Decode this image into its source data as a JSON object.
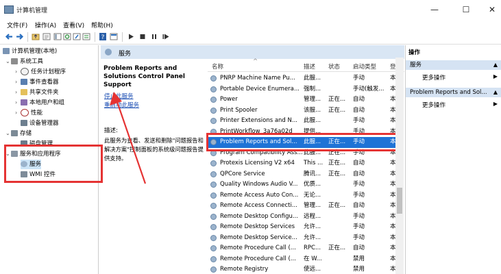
{
  "window": {
    "title": "计算机管理",
    "min": "—",
    "max": "☐",
    "close": "✕"
  },
  "menu": [
    "文件(F)",
    "操作(A)",
    "查看(V)",
    "帮助(H)"
  ],
  "tree": {
    "root": "计算机管理(本地)",
    "system_tools": "系统工具",
    "task_scheduler": "任务计划程序",
    "event_viewer": "事件查看器",
    "shared_folders": "共享文件夹",
    "local_users": "本地用户和组",
    "performance": "性能",
    "device_manager": "设备管理器",
    "storage": "存储",
    "disk_mgmt": "磁盘管理",
    "services_apps": "服务和应用程序",
    "services": "服务",
    "wmi": "WMI 控件"
  },
  "main": {
    "header": "服务",
    "desc_title": "Problem Reports and Solutions Control Panel Support",
    "stop_link": "停止此服务",
    "restart_link": "重启动此服务",
    "desc_label": "描述:",
    "desc_text": "此服务为查看、发送和删除\"问题报告和解决方案\"控制面板的系统级问题报告提供支持。"
  },
  "columns": {
    "name": "名称",
    "desc": "描述",
    "status": "状态",
    "startup": "启动类型",
    "logon": "登"
  },
  "services": [
    {
      "name": "PNRP Machine Name Pu...",
      "desc": "此服...",
      "status": "",
      "startup": "手动",
      "logon": "本"
    },
    {
      "name": "Portable Device Enumera...",
      "desc": "强制...",
      "status": "",
      "startup": "手动(触发...",
      "logon": "本"
    },
    {
      "name": "Power",
      "desc": "管理...",
      "status": "正在...",
      "startup": "自动",
      "logon": "本"
    },
    {
      "name": "Print Spooler",
      "desc": "该服...",
      "status": "正在...",
      "startup": "自动",
      "logon": "本"
    },
    {
      "name": "Printer Extensions and N...",
      "desc": "此服...",
      "status": "",
      "startup": "手动",
      "logon": "本"
    },
    {
      "name": "PrintWorkflow_3a76a02d",
      "desc": "提供...",
      "status": "",
      "startup": "手动",
      "logon": "本"
    },
    {
      "name": "Problem Reports and Sol...",
      "desc": "此服...",
      "status": "正在...",
      "startup": "手动",
      "logon": "本"
    },
    {
      "name": "Program Compatibility Ass...",
      "desc": "此服...",
      "status": "正在...",
      "startup": "手动",
      "logon": "本"
    },
    {
      "name": "Protexis Licensing V2 x64",
      "desc": "This ...",
      "status": "正在...",
      "startup": "自动",
      "logon": "本"
    },
    {
      "name": "QPCore Service",
      "desc": "腾讯...",
      "status": "正在...",
      "startup": "自动",
      "logon": "本"
    },
    {
      "name": "Quality Windows Audio V...",
      "desc": "优质...",
      "status": "",
      "startup": "手动",
      "logon": "本"
    },
    {
      "name": "Remote Access Auto Con...",
      "desc": "无论...",
      "status": "",
      "startup": "手动",
      "logon": "本"
    },
    {
      "name": "Remote Access Connecti...",
      "desc": "管理...",
      "status": "正在...",
      "startup": "自动",
      "logon": "本"
    },
    {
      "name": "Remote Desktop Configu...",
      "desc": "远程...",
      "status": "",
      "startup": "手动",
      "logon": "本"
    },
    {
      "name": "Remote Desktop Services",
      "desc": "允许...",
      "status": "",
      "startup": "手动",
      "logon": "本"
    },
    {
      "name": "Remote Desktop Service...",
      "desc": "允许...",
      "status": "",
      "startup": "手动",
      "logon": "本"
    },
    {
      "name": "Remote Procedure Call (...",
      "desc": "RPC...",
      "status": "正在...",
      "startup": "自动",
      "logon": "本"
    },
    {
      "name": "Remote Procedure Call (...",
      "desc": "在 W...",
      "status": "",
      "startup": "禁用",
      "logon": "本"
    },
    {
      "name": "Remote Registry",
      "desc": "使远...",
      "status": "",
      "startup": "禁用",
      "logon": "本"
    }
  ],
  "actions": {
    "title": "操作",
    "services": "服务",
    "more1": "更多操作",
    "selected": "Problem Reports and Sol...",
    "more2": "更多操作"
  },
  "colors": {
    "selection": "#1e73d6",
    "annotation_red": "#e53333",
    "header_blue": "#d9e6f4"
  },
  "icons": [
    "app-icon",
    "back-icon",
    "forward-icon",
    "up-icon",
    "properties-icon",
    "refresh-icon",
    "export-icon",
    "help-icon",
    "play-icon",
    "stop-icon",
    "pause-icon",
    "restart-icon",
    "gear-icon"
  ]
}
